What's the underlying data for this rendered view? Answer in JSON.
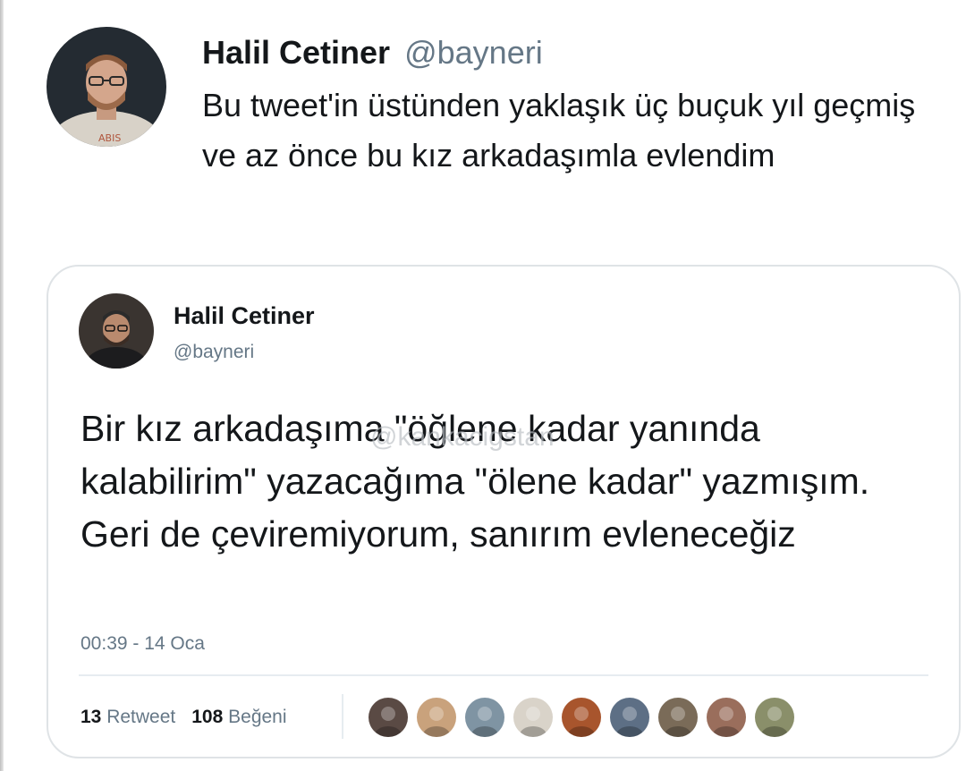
{
  "tweet": {
    "author_name": "Halil Cetiner",
    "author_handle": "@bayneri",
    "text": "Bu tweet'in üstünden yaklaşık üç buçuk yıl geçmiş ve az önce bu kız arkadaşımla evlendim"
  },
  "quoted_tweet": {
    "author_name": "Halil Cetiner",
    "author_handle": "@bayneri",
    "text": "Bir kız arkadaşıma \"öğlene kadar yanında kalabilirim\" yazacağıma \"ölene kadar\" yazmışım. Geri de çeviremiyorum, sanırım evleneceğiz",
    "timestamp": "00:39 - 14 Oca",
    "watermark": "@kankacigstan",
    "retweet_count": "13",
    "retweet_label": "Retweet",
    "like_count": "108",
    "like_label": "Beğeni",
    "likers": [
      {
        "icon": "avatar-woman-dark-hair-icon",
        "color": "#5a4a44"
      },
      {
        "icon": "avatar-cartoon-face-icon",
        "color": "#c9a27c"
      },
      {
        "icon": "avatar-landscape-icon",
        "color": "#7f94a3"
      },
      {
        "icon": "avatar-sketch-icon",
        "color": "#d9d3c9"
      },
      {
        "icon": "avatar-figure-icon",
        "color": "#a8552d"
      },
      {
        "icon": "avatar-sunset-icon",
        "color": "#5d6f85"
      },
      {
        "icon": "avatar-lion-icon",
        "color": "#7a6b58"
      },
      {
        "icon": "avatar-woman-icon",
        "color": "#9a6e5c"
      },
      {
        "icon": "avatar-nature-icon",
        "color": "#8a8f6a"
      }
    ]
  },
  "colors": {
    "text": "#14171a",
    "secondary": "#657786",
    "border": "#dfe3e6"
  }
}
